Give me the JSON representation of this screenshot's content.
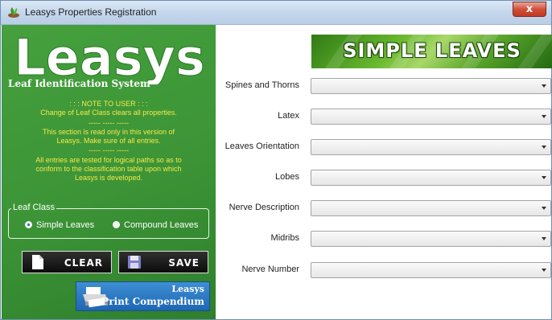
{
  "window": {
    "title": "Leasys Properties Registration",
    "close_label": "x"
  },
  "left_panel": {
    "logo_text": "Leasys",
    "subtitle": "Leaf Identification System",
    "notes": [
      ": : : NOTE TO USER : : :",
      "Change of Leaf Class clears all properties.",
      "----- ----- -----",
      "This section is read only in this version of",
      "Leasys. Make sure of all entries.",
      "----- ----- -----",
      "All entries are tested for logical paths so as to",
      "conform to the classification table upon which",
      "Leasys is developed."
    ],
    "leaf_class": {
      "legend": "Leaf Class",
      "options": [
        {
          "label": "Simple Leaves",
          "selected": true
        },
        {
          "label": "Compound Leaves",
          "selected": false
        }
      ]
    },
    "clear_label": "CLEAR",
    "save_label": "SAVE",
    "print": {
      "line1": "Leasys",
      "line2": "Print Compendium"
    }
  },
  "banner": {
    "text": "SIMPLE LEAVES"
  },
  "fields": [
    {
      "label": "Spines and Thorns",
      "value": ""
    },
    {
      "label": "Latex",
      "value": ""
    },
    {
      "label": "Leaves Orientation",
      "value": ""
    },
    {
      "label": "Lobes",
      "value": ""
    },
    {
      "label": "Nerve Description",
      "value": ""
    },
    {
      "label": "Midribs",
      "value": ""
    },
    {
      "label": "Nerve Number",
      "value": ""
    }
  ],
  "colors": {
    "panel_green": "#3c9436",
    "note_yellow": "#f4e84a",
    "button_dark": "#111111",
    "print_blue": "#2a78c4"
  }
}
